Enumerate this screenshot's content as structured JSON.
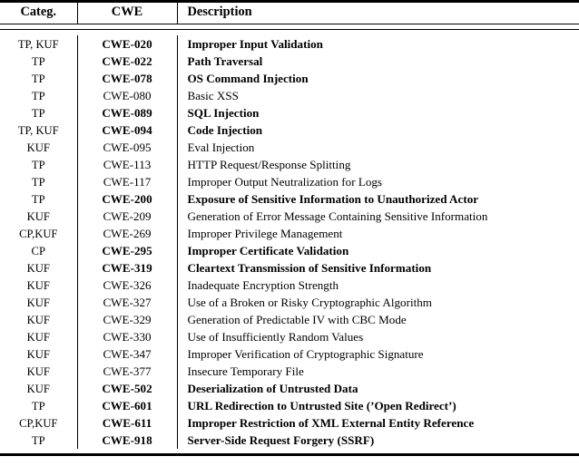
{
  "table": {
    "columns": [
      {
        "key": "category",
        "label": "Categ."
      },
      {
        "key": "cwe",
        "label": "CWE"
      },
      {
        "key": "description",
        "label": "Description"
      }
    ],
    "rows": [
      {
        "category": "TP, KUF",
        "cwe": "CWE-020",
        "description": "Improper Input Validation",
        "bold": true
      },
      {
        "category": "TP",
        "cwe": "CWE-022",
        "description": "Path Traversal",
        "bold": true
      },
      {
        "category": "TP",
        "cwe": "CWE-078",
        "description": "OS Command Injection",
        "bold": true
      },
      {
        "category": "TP",
        "cwe": "CWE-080",
        "description": "Basic XSS",
        "bold": false
      },
      {
        "category": "TP",
        "cwe": "CWE-089",
        "description": "SQL Injection",
        "bold": true
      },
      {
        "category": "TP, KUF",
        "cwe": "CWE-094",
        "description": "Code Injection",
        "bold": true
      },
      {
        "category": "KUF",
        "cwe": "CWE-095",
        "description": "Eval Injection",
        "bold": false
      },
      {
        "category": "TP",
        "cwe": "CWE-113",
        "description": "HTTP Request/Response Splitting",
        "bold": false
      },
      {
        "category": "TP",
        "cwe": "CWE-117",
        "description": "Improper Output Neutralization for Logs",
        "bold": false
      },
      {
        "category": "TP",
        "cwe": "CWE-200",
        "description": "Exposure of Sensitive Information to Unauthorized Actor",
        "bold": true
      },
      {
        "category": "KUF",
        "cwe": "CWE-209",
        "description": "Generation of Error Message Containing Sensitive Information",
        "bold": false
      },
      {
        "category": "CP,KUF",
        "cwe": "CWE-269",
        "description": "Improper Privilege Management",
        "bold": false
      },
      {
        "category": "CP",
        "cwe": "CWE-295",
        "description": "Improper Certificate Validation",
        "bold": true
      },
      {
        "category": "KUF",
        "cwe": "CWE-319",
        "description": "Cleartext Transmission of Sensitive Information",
        "bold": true
      },
      {
        "category": "KUF",
        "cwe": "CWE-326",
        "description": "Inadequate Encryption Strength",
        "bold": false
      },
      {
        "category": "KUF",
        "cwe": "CWE-327",
        "description": "Use of a Broken or Risky Cryptographic Algorithm",
        "bold": false
      },
      {
        "category": "KUF",
        "cwe": "CWE-329",
        "description": "Generation of Predictable IV with CBC Mode",
        "bold": false
      },
      {
        "category": "KUF",
        "cwe": "CWE-330",
        "description": "Use of Insufficiently Random Values",
        "bold": false
      },
      {
        "category": "KUF",
        "cwe": "CWE-347",
        "description": "Improper Verification of Cryptographic Signature",
        "bold": false
      },
      {
        "category": "KUF",
        "cwe": "CWE-377",
        "description": "Insecure Temporary File",
        "bold": false
      },
      {
        "category": "KUF",
        "cwe": "CWE-502",
        "description": "Deserialization of Untrusted Data",
        "bold": true
      },
      {
        "category": "TP",
        "cwe": "CWE-601",
        "description": "URL Redirection to Untrusted Site (’Open Redirect’)",
        "bold": true
      },
      {
        "category": "CP,KUF",
        "cwe": "CWE-611",
        "description": "Improper Restriction of XML External Entity Reference",
        "bold": true
      },
      {
        "category": "TP",
        "cwe": "CWE-918",
        "description": "Server-Side Request Forgery (SSRF)",
        "bold": true
      }
    ]
  }
}
